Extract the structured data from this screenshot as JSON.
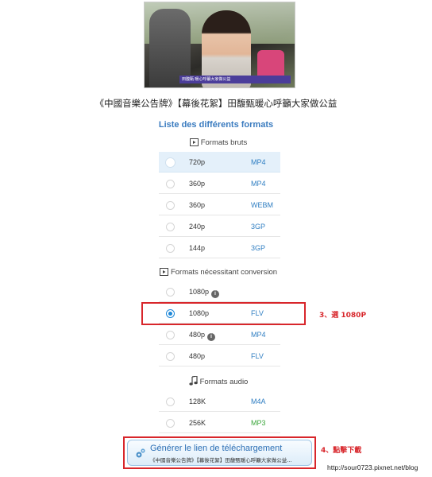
{
  "video": {
    "thumbnail_caption": "田馥甄 暖心呼籲大家做公益",
    "title": "《中國音樂公告牌》【幕後花絮】田馥甄暖心呼籲大家做公益"
  },
  "formats_heading": "Liste des différents formats",
  "sections": {
    "raw": {
      "label": "Formats bruts",
      "icon": "video-icon"
    },
    "conversion": {
      "label": "Formats nécessitant conversion",
      "icon": "video-icon"
    },
    "audio": {
      "label": "Formats audio",
      "icon": "music-note-icon"
    }
  },
  "raw_formats": [
    {
      "res": "720p",
      "fmt": "MP4"
    },
    {
      "res": "360p",
      "fmt": "MP4"
    },
    {
      "res": "360p",
      "fmt": "WEBM"
    },
    {
      "res": "240p",
      "fmt": "3GP"
    },
    {
      "res": "144p",
      "fmt": "3GP"
    }
  ],
  "conversion_formats": [
    {
      "res": "1080p",
      "fmt": "",
      "info": "i"
    },
    {
      "res": "1080p",
      "fmt": "FLV",
      "selected": true
    },
    {
      "res": "480p",
      "fmt": "MP4",
      "info": "i"
    },
    {
      "res": "480p",
      "fmt": "FLV"
    }
  ],
  "audio_formats": [
    {
      "res": "128K",
      "fmt": "M4A"
    },
    {
      "res": "256K",
      "fmt": "MP3"
    }
  ],
  "annotations": {
    "step3": "3、選 1080P",
    "step4": "4、點擊下載"
  },
  "generate_button": {
    "label": "Générer le lien de téléchargement",
    "subtitle": "《中國音樂公告牌》【幕後花絮】田馥甄暖心呼籲大家做公益..."
  },
  "footer": "http://sour0723.pixnet.net/blog",
  "colors": {
    "accent": "#2f7ec2",
    "annotation_red": "#d8262b",
    "selected_row": "#e4f0fa"
  }
}
